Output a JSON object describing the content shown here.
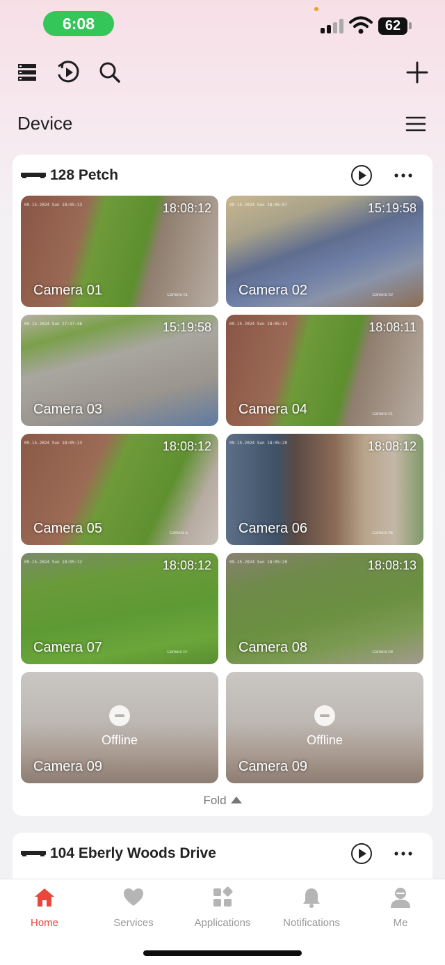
{
  "status_bar": {
    "time": "6:08",
    "battery": "62",
    "colors": {
      "time_pill": "#35c65a",
      "privacy_dot": "#f0a020"
    }
  },
  "toolbar": {
    "icons": [
      "device-list-icon",
      "playback-icon",
      "search-icon",
      "add-icon"
    ]
  },
  "page": {
    "title": "Device"
  },
  "devices": [
    {
      "name": "128 Petch",
      "cameras": [
        {
          "name": "Camera 01",
          "timestamp": "18:08:12",
          "osd": "09-15-2024 Sun 18:05:13",
          "tag": "Camera 01",
          "status": "online"
        },
        {
          "name": "Camera 02",
          "timestamp": "15:19:58",
          "osd": "09-15-2024 Sun 18:06:07",
          "tag": "Camera 02",
          "status": "online"
        },
        {
          "name": "Camera 03",
          "timestamp": "15:19:58",
          "osd": "09-15-2024 Sun 17:37:46",
          "tag": "",
          "status": "online"
        },
        {
          "name": "Camera 04",
          "timestamp": "18:08:11",
          "osd": "09-15-2024 Sun 18:05:13",
          "tag": "Camera 01",
          "status": "online"
        },
        {
          "name": "Camera 05",
          "timestamp": "18:08:12",
          "osd": "09-15-2024 Sun 18:05:13",
          "tag": "Camera 5",
          "status": "online"
        },
        {
          "name": "Camera 06",
          "timestamp": "18:08:12",
          "osd": "09-15-2024 Sun 18:05:20",
          "tag": "Camera 06",
          "status": "online"
        },
        {
          "name": "Camera 07",
          "timestamp": "18:08:12",
          "osd": "09-15-2024 Sun 18:05:12",
          "tag": "Camera 07",
          "status": "online"
        },
        {
          "name": "Camera 08",
          "timestamp": "18:08:13",
          "osd": "09-15-2024 Sun 18:05:20",
          "tag": "Camera 08",
          "status": "online"
        },
        {
          "name": "Camera 09",
          "status_label": "Offline",
          "status": "offline"
        },
        {
          "name": "Camera 09",
          "status_label": "Offline",
          "status": "offline"
        }
      ],
      "fold_label": "Fold"
    },
    {
      "name": "104 Eberly Woods Drive"
    }
  ],
  "tabbar": {
    "tabs": [
      {
        "label": "Home",
        "icon": "home-icon",
        "active": true
      },
      {
        "label": "Services",
        "icon": "heart-icon",
        "active": false
      },
      {
        "label": "Applications",
        "icon": "apps-icon",
        "active": false
      },
      {
        "label": "Notifications",
        "icon": "bell-icon",
        "active": false
      },
      {
        "label": "Me",
        "icon": "person-icon",
        "active": false
      }
    ],
    "colors": {
      "active": "#e8473b",
      "inactive": "#999999"
    }
  }
}
